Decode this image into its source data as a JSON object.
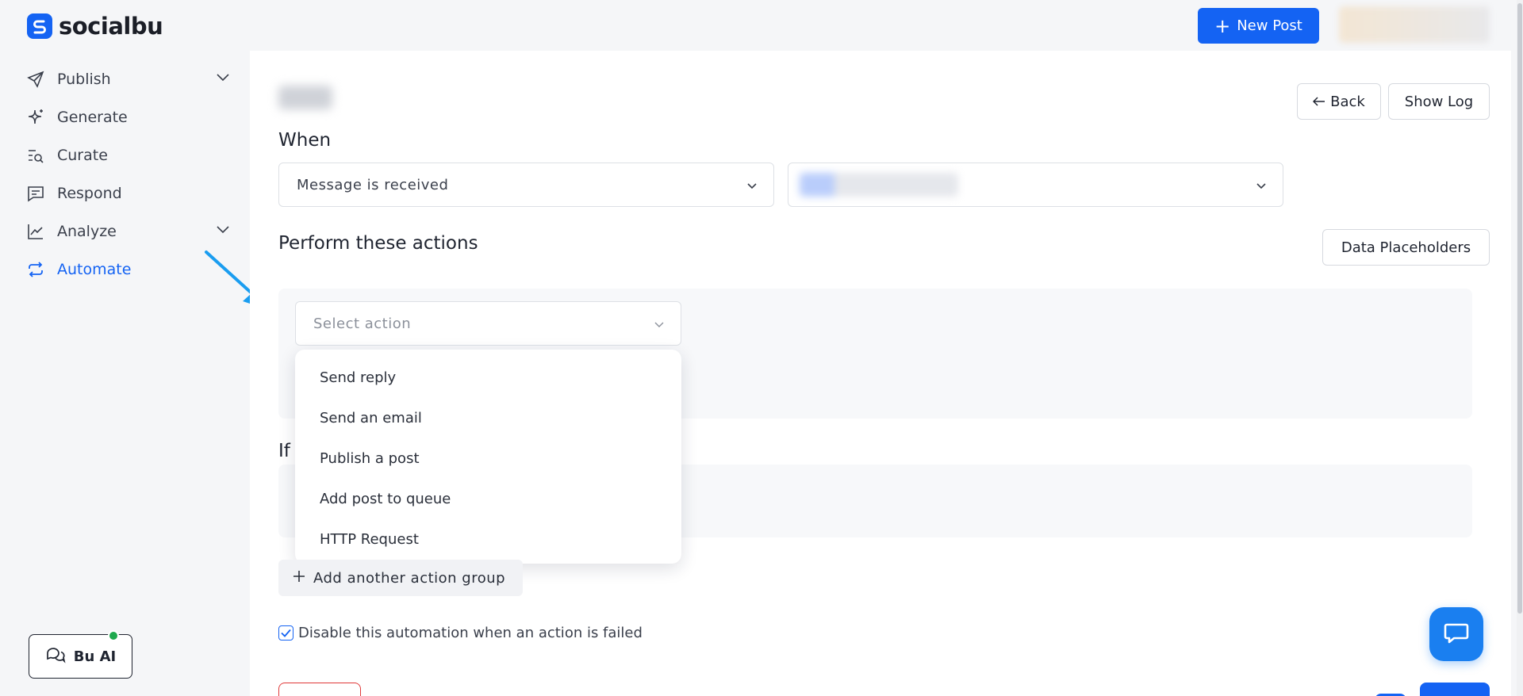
{
  "header": {
    "brand": "socialbu",
    "new_post_label": "New Post"
  },
  "sidebar": {
    "items": [
      {
        "label": "Publish",
        "icon": "send-icon",
        "has_chevron": true
      },
      {
        "label": "Generate",
        "icon": "sparkle-icon",
        "has_chevron": false
      },
      {
        "label": "Curate",
        "icon": "curate-search-icon",
        "has_chevron": false
      },
      {
        "label": "Respond",
        "icon": "message-icon",
        "has_chevron": false
      },
      {
        "label": "Analyze",
        "icon": "chart-icon",
        "has_chevron": true
      },
      {
        "label": "Automate",
        "icon": "repeat-icon",
        "has_chevron": false,
        "active": true
      }
    ],
    "bu_ai_label": "Bu AI"
  },
  "main": {
    "back_label": "Back",
    "show_log_label": "Show Log",
    "when_label": "When",
    "trigger_select": "Message is received",
    "perform_label": "Perform these actions",
    "data_placeholders_label": "Data Placeholders",
    "select_action_placeholder": "Select action",
    "action_options": [
      "Send reply",
      "Send an email",
      "Publish a post",
      "Add post to queue",
      "HTTP Request"
    ],
    "if_label": "If",
    "add_group_label": "Add another action group",
    "disable_checkbox_label": "Disable this automation when an action is failed",
    "disable_checked": true
  },
  "colors": {
    "accent": "#1463f3",
    "fab": "#1a7ff0",
    "annotation_arrow": "#1a9df0",
    "danger": "#e03a3a",
    "online": "#1ea94d"
  }
}
